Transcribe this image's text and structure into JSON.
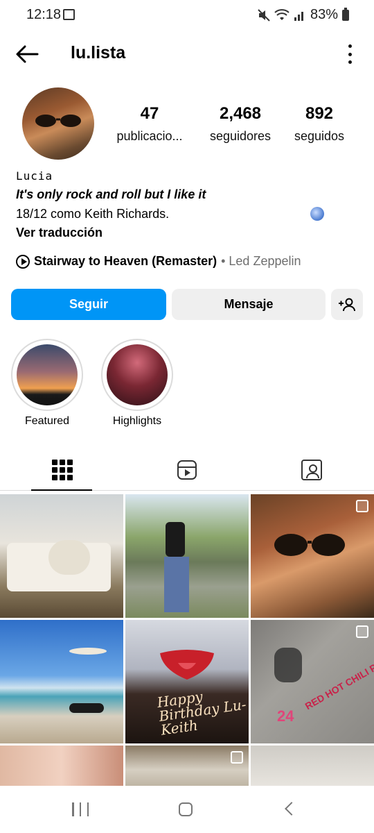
{
  "status_bar": {
    "time": "12:18",
    "battery": "83%"
  },
  "header": {
    "username": "lu.lista"
  },
  "profile": {
    "stats": [
      {
        "value": "47",
        "label": "publicacio..."
      },
      {
        "value": "2,468",
        "label": "seguidores"
      },
      {
        "value": "892",
        "label": "seguidos"
      }
    ],
    "display_name": "Lucia",
    "bio_line1": "It's only rock and roll but I like it",
    "bio_line2": "18/12 como Keith Richards.",
    "translate_label": "Ver traducción",
    "music": {
      "song": "Stairway to Heaven (Remaster)",
      "artist": "• Led Zeppelin"
    }
  },
  "actions": {
    "follow_label": "Seguir",
    "message_label": "Mensaje"
  },
  "highlights": [
    {
      "label": "Featured"
    },
    {
      "label": "Highlights"
    }
  ],
  "tabs": [
    "posts-grid",
    "reels",
    "tagged"
  ],
  "posts": {
    "cake_text": "Happy Birthday Lu-Keith",
    "chalk_text": "RED HOT CHILI PEPPERS",
    "chalk_date": "24"
  }
}
